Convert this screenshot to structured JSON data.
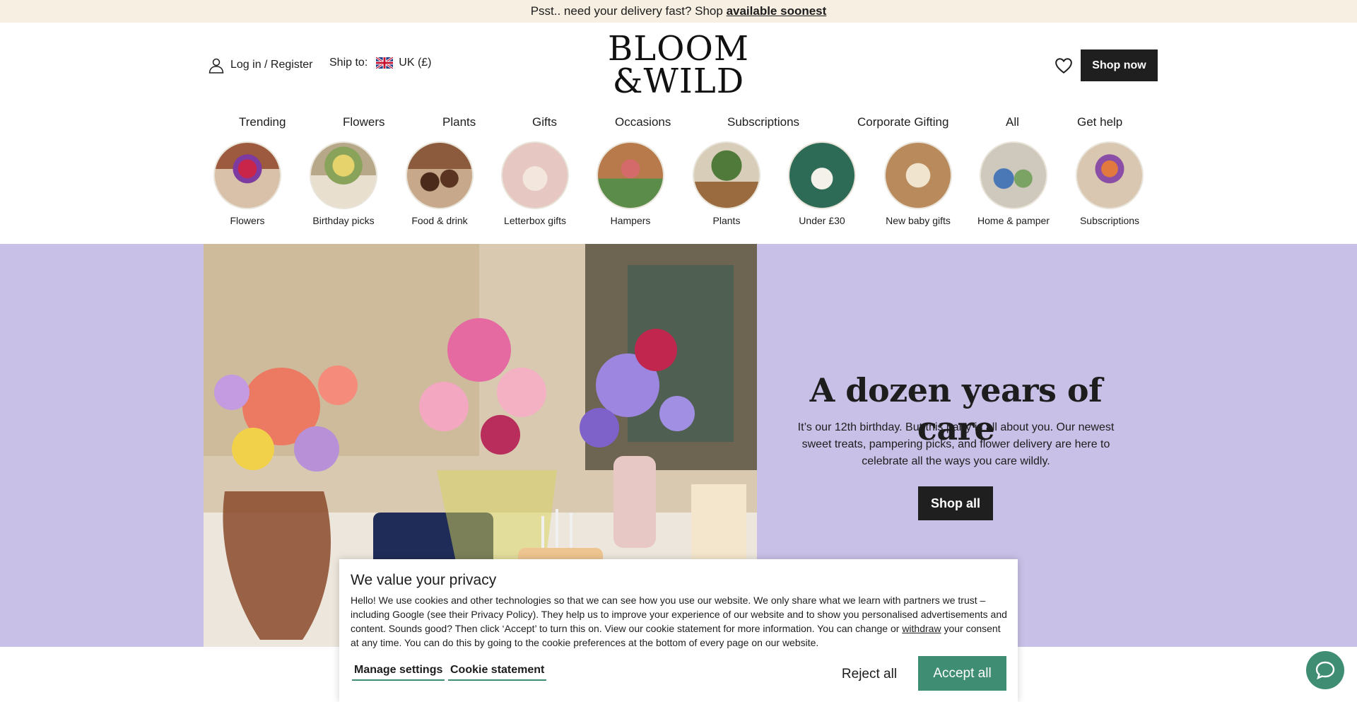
{
  "promo": {
    "text": "Psst.. need your delivery fast? Shop ",
    "link": "available soonest"
  },
  "header": {
    "login_label": "Log in / Register",
    "ship_label": "Ship to:",
    "currency": "UK (£)",
    "logo_line1": "BLOOM",
    "logo_line2": "&WILD",
    "shop_now": "Shop now",
    "icons": [
      "user-icon",
      "uk-flag-icon",
      "heart-icon"
    ]
  },
  "nav": {
    "items": [
      "Trending",
      "Flowers",
      "Plants",
      "Gifts",
      "Occasions",
      "Subscriptions",
      "Corporate Gifting",
      "All",
      "Get help"
    ]
  },
  "categories": {
    "items": [
      "Flowers",
      "Birthday picks",
      "Food & drink",
      "Letterbox gifts",
      "Hampers",
      "Plants",
      "Under £30",
      "New baby gifts",
      "Home & pamper",
      "Subscriptions"
    ]
  },
  "hero": {
    "title": "A dozen years of care",
    "text": "It’s our 12th birthday. But this party is all about you. Our newest sweet treats, pampering picks, and flower delivery are here to celebrate all the ways you care wildly.",
    "cta": "Shop all",
    "background": "#c8c0e6"
  },
  "cookie": {
    "title": "We value your privacy",
    "body_before": "Hello! We use cookies and other technologies so that we can see how you use our website. We only share what we learn with partners we trust – including Google (see their Privacy Policy). They help us to improve your experience of our website and to show you personalised advertisements and content. Sounds good? Then click ‘Accept’ to turn this on. View our cookie statement for more information. You can change or ",
    "withdraw": "withdraw",
    "body_after": " your consent at any time. You can do this by going to the cookie preferences at the bottom of every page on our website.",
    "manage": "Manage settings",
    "statement": "Cookie statement",
    "reject": "Reject all",
    "accept": "Accept all",
    "accent": "#3f8d72"
  },
  "chat": {
    "icon": "chat-icon"
  }
}
